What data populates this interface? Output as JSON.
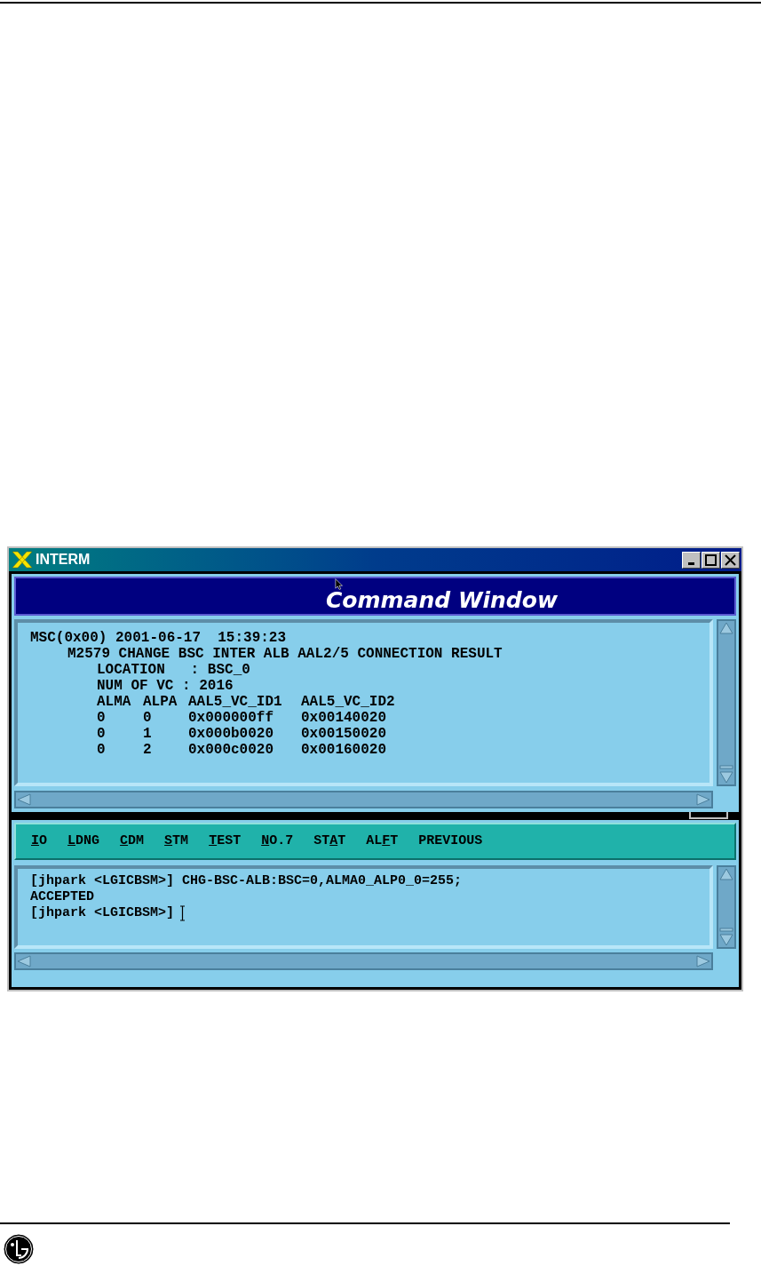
{
  "window": {
    "title": "INTERM"
  },
  "header": {
    "title": "Command Window"
  },
  "output": {
    "timestamp": "MSC(0x00) 2001-06-17  15:39:23",
    "message": "M2579 CHANGE BSC INTER ALB AAL2/5 CONNECTION RESULT",
    "fields": [
      "LOCATION   : BSC_0",
      "NUM OF VC : 2016"
    ],
    "table": {
      "columns": [
        "ALMA",
        "ALPA",
        "AAL5_VC_ID1",
        "AAL5_VC_ID2"
      ],
      "rows": [
        [
          "0",
          "0",
          "0x000000ff",
          "0x00140020"
        ],
        [
          "0",
          "1",
          "0x000b0020",
          "0x00150020"
        ],
        [
          "0",
          "2",
          "0x000c0020",
          "0x00160020"
        ]
      ]
    }
  },
  "menu": [
    {
      "key": "I",
      "after": "O"
    },
    {
      "key": "L",
      "after": "DNG"
    },
    {
      "key": "C",
      "after": "DM"
    },
    {
      "key": "S",
      "after": "TM"
    },
    {
      "key": "T",
      "after": "EST"
    },
    {
      "key": "N",
      "after": "O.7"
    },
    {
      "before": "ST",
      "key": "A",
      "after": "T"
    },
    {
      "before": "AL",
      "key": "F",
      "after": "T"
    },
    {
      "before": "PREVIOUS"
    }
  ],
  "console": {
    "lines": [
      "[jhpark <LGICBSM>] CHG-BSC-ALB:BSC=0,ALMA0_ALP0_0=255;",
      "ACCEPTED"
    ],
    "prompt": "[jhpark <LGICBSM>]"
  }
}
